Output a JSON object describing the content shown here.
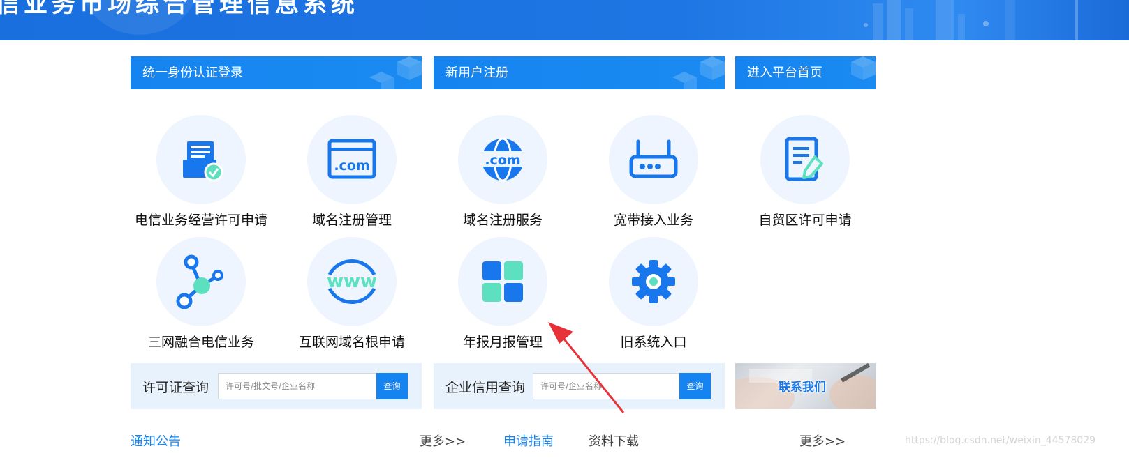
{
  "header": {
    "title": "信业务市场综合管理信息系统"
  },
  "tabs": [
    {
      "label": "统一身份认证登录"
    },
    {
      "label": "新用户注册"
    },
    {
      "label": "进入平台首页"
    }
  ],
  "tiles": [
    {
      "label": "电信业务经营许可申请",
      "icon": "license-application-icon"
    },
    {
      "label": "域名注册管理",
      "icon": "domain-com-window-icon"
    },
    {
      "label": "域名注册服务",
      "icon": "globe-com-icon"
    },
    {
      "label": "宽带接入业务",
      "icon": "router-icon"
    },
    {
      "label": "自贸区许可申请",
      "icon": "document-edit-icon"
    },
    {
      "label": "三网融合电信业务",
      "icon": "network-nodes-icon"
    },
    {
      "label": "互联网域名根申请",
      "icon": "www-icon"
    },
    {
      "label": "年报月报管理",
      "icon": "grid-blocks-icon"
    },
    {
      "label": "旧系统入口",
      "icon": "gear-icon"
    }
  ],
  "license_query": {
    "label": "许可证查询",
    "placeholder": "许可号/批文号/企业名称",
    "button": "查询"
  },
  "credit_query": {
    "label": "企业信用查询",
    "placeholder": "许可号/企业名称",
    "button": "查询"
  },
  "contact": {
    "label": "联系我们"
  },
  "bottom": {
    "notices": "通知公告",
    "more_left": "更多>>",
    "guide": "申请指南",
    "downloads": "资料下载",
    "more_right": "更多>>"
  },
  "watermark": "https://blog.csdn.net/weixin_44578029",
  "colors": {
    "primary": "#1684f0",
    "banner": "#1a6fde",
    "tile_bg": "#eef5fe",
    "query_bg": "#e8f2fd",
    "accent_green": "#5de0c0",
    "arrow": "#e8323a"
  }
}
